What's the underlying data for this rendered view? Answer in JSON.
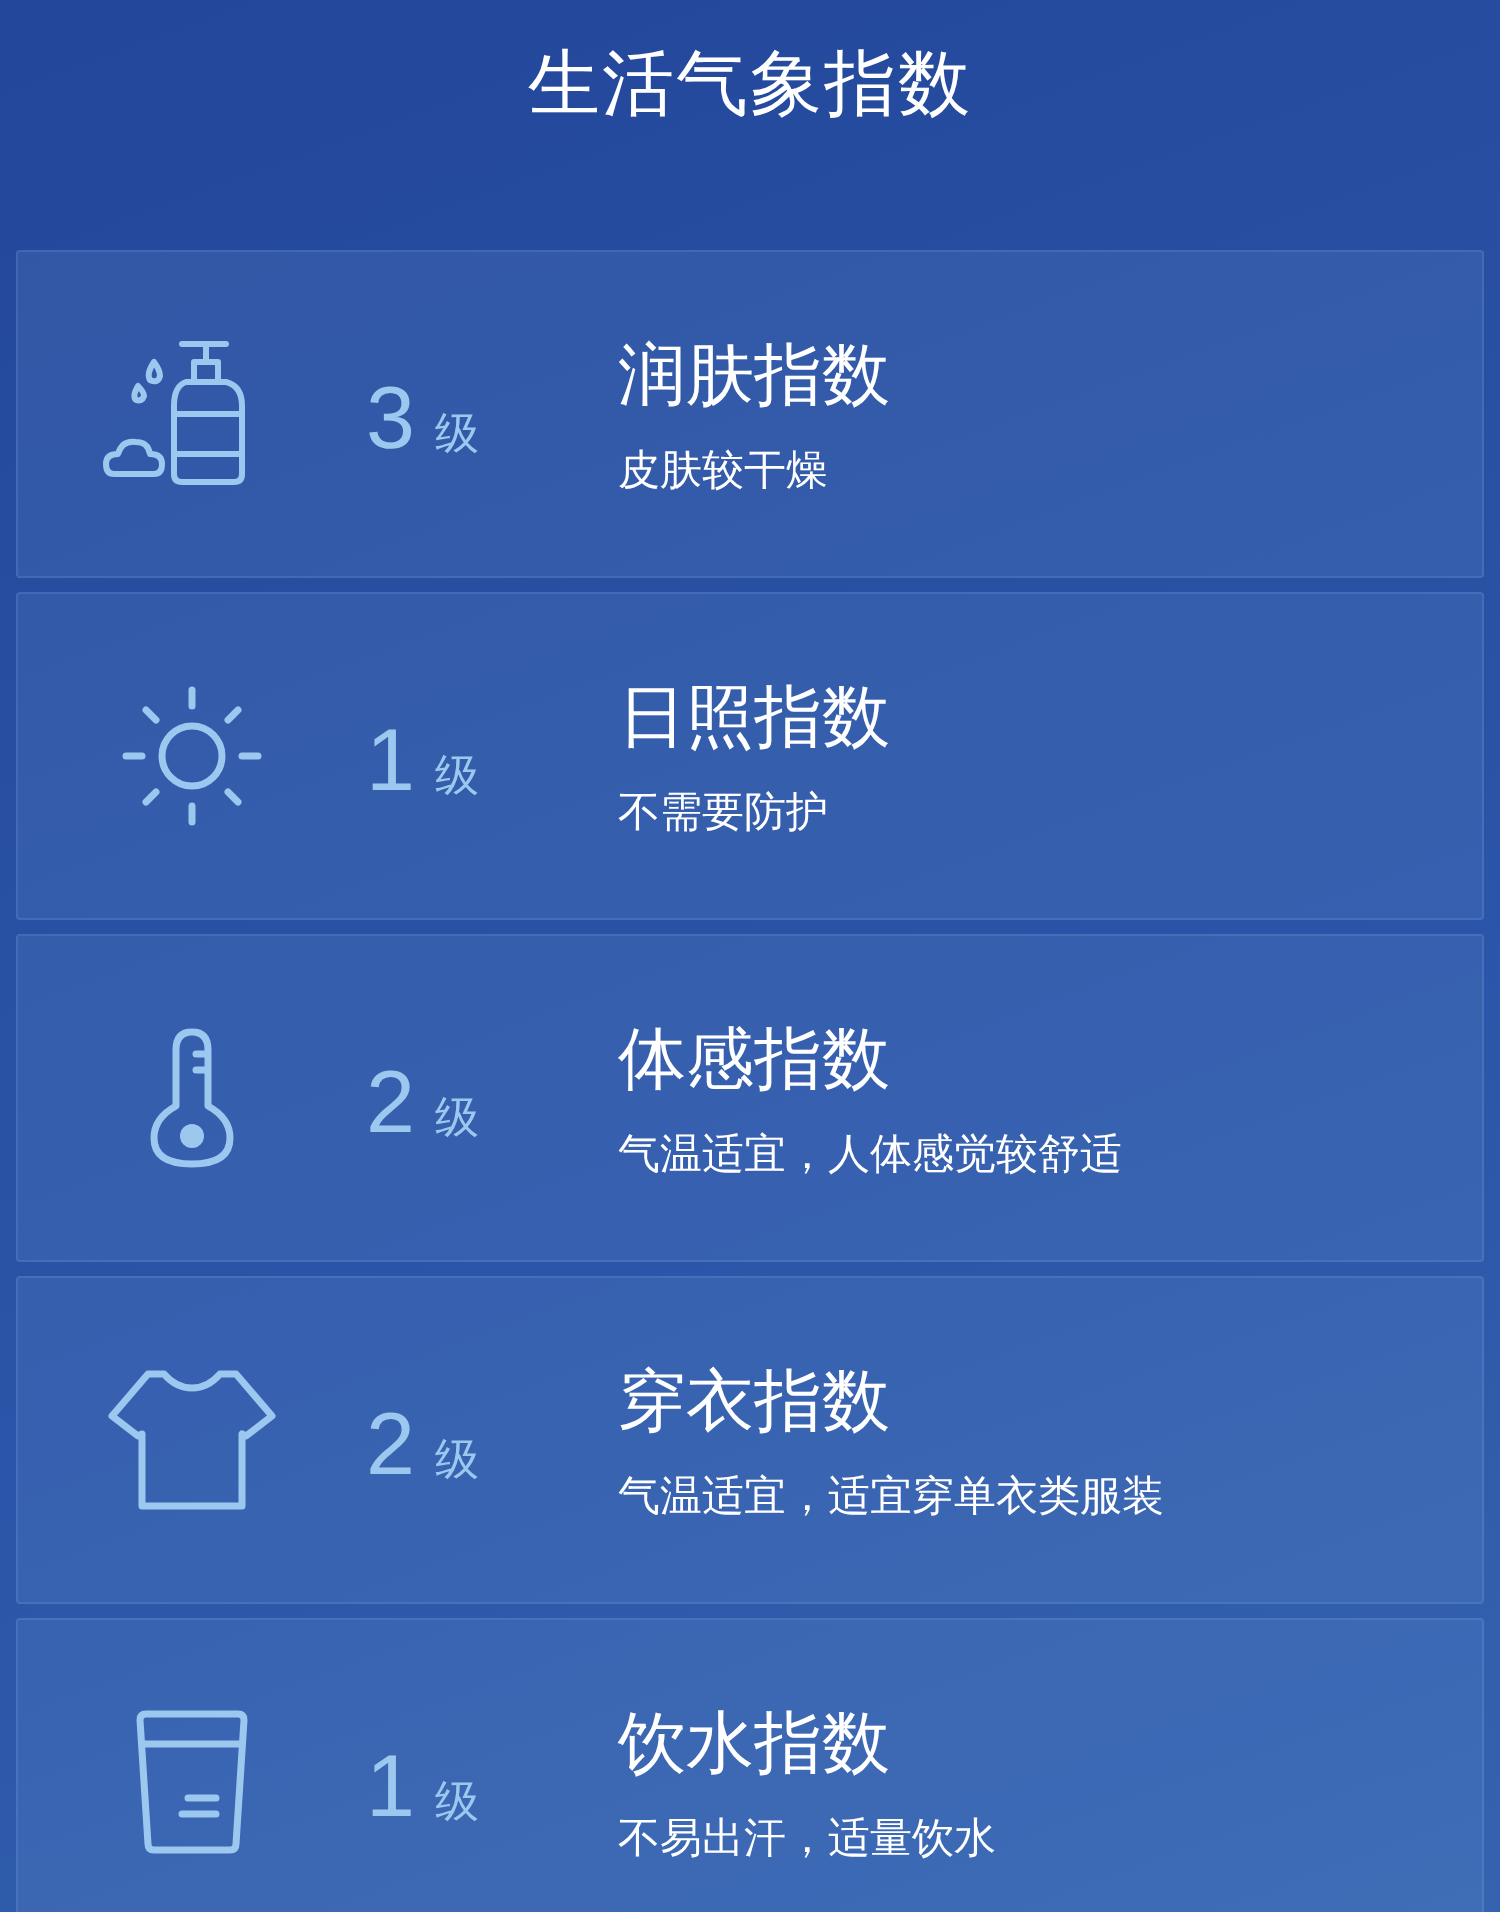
{
  "title": "生活气象指数",
  "indices": [
    {
      "kind": "lotion",
      "level": "3",
      "unit": "级",
      "name": "润肤指数",
      "advice": "皮肤较干燥"
    },
    {
      "kind": "sun",
      "level": "1",
      "unit": "级",
      "name": "日照指数",
      "advice": "不需要防护"
    },
    {
      "kind": "thermometer",
      "level": "2",
      "unit": "级",
      "name": "体感指数",
      "advice": "气温适宜，人体感觉较舒适"
    },
    {
      "kind": "shirt",
      "level": "2",
      "unit": "级",
      "name": "穿衣指数",
      "advice": "气温适宜，适宜穿单衣类服装"
    },
    {
      "kind": "cup",
      "level": "1",
      "unit": "级",
      "name": "饮水指数",
      "advice": "不易出汗，适量饮水"
    }
  ]
}
